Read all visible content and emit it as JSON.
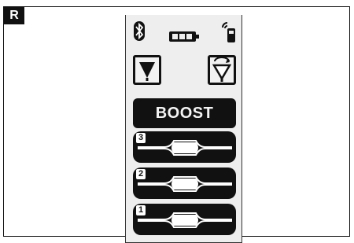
{
  "figure": {
    "tag": "R"
  },
  "remote": {
    "status": {
      "bluetooth_icon": "bluetooth-icon",
      "battery_icon": "battery-icon",
      "signal_icon": "remote-signal-icon"
    },
    "filter_down_icon": "filter-icon",
    "filter_cycle_icon": "filter-rotate-icon",
    "boost_label": "BOOST",
    "levels": [
      {
        "number": "3"
      },
      {
        "number": "2"
      },
      {
        "number": "1"
      }
    ]
  }
}
